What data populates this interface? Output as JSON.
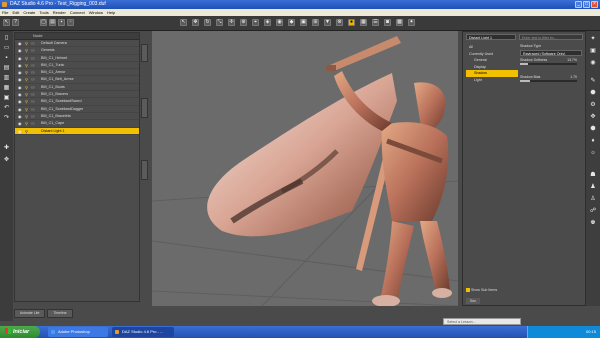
{
  "window": {
    "title": "DAZ Studio 4.6 Pro - Test_Rigging_003.duf"
  },
  "menu": [
    "File",
    "Edit",
    "Create",
    "Tools",
    "Render",
    "Connect",
    "Window",
    "Help"
  ],
  "scene": {
    "header": "Node",
    "rows": [
      {
        "label": "Default Camera",
        "selected": false
      },
      {
        "label": "Genesis",
        "selected": false
      },
      {
        "label": "BM_C1_Helmet",
        "selected": false
      },
      {
        "label": "BM_C1_Tunic",
        "selected": false
      },
      {
        "label": "BM_C1_Armor",
        "selected": false
      },
      {
        "label": "BM_C1_Belt_Armor",
        "selected": false
      },
      {
        "label": "BM_C1_Boots",
        "selected": false
      },
      {
        "label": "BM_C1_Bracers",
        "selected": false
      },
      {
        "label": "BM_C1_ScabbardSword",
        "selected": false
      },
      {
        "label": "BM_C1_ScabbardDagger",
        "selected": false
      },
      {
        "label": "BM_C1_Bracelets",
        "selected": false
      },
      {
        "label": "BM_C1_Cape",
        "selected": false
      },
      {
        "label": "Distant Light 1",
        "selected": true
      }
    ]
  },
  "bottom_tabs": [
    "Animate Lite",
    "Timeline"
  ],
  "params": {
    "node_select": "Distant Light 1",
    "list": [
      {
        "label": "All",
        "indent": false,
        "selected": false
      },
      {
        "label": "Currently Used",
        "indent": false,
        "selected": false
      },
      {
        "label": "General",
        "indent": true,
        "selected": false
      },
      {
        "label": "Display",
        "indent": true,
        "selected": false
      },
      {
        "label": "Shadow",
        "indent": true,
        "selected": true
      },
      {
        "label": "Light",
        "indent": true,
        "selected": false
      }
    ],
    "filter_placeholder": "Enter text to filter by...",
    "shadow_type_label": "Shadow Type",
    "shadow_type_value": "Raytraced (Software Only)",
    "shadow_softness_label": "Shadow Softness",
    "shadow_softness_value": "13.7%",
    "shadow_softness_fraction": 0.137,
    "shadow_bias_label": "Shadow Bias",
    "shadow_bias_value": "1.70",
    "shadow_bias_fraction": 0.17,
    "show_sub_items": "Show Sub Items",
    "footer": "Sec"
  },
  "lesson": {
    "placeholder": "Select a Lesson..."
  },
  "taskbar": {
    "start": "Iniciar",
    "tasks": [
      "Adobe Photoshop",
      "DAZ Studio 4.6 Pro - ..."
    ],
    "clock": "00:15"
  }
}
